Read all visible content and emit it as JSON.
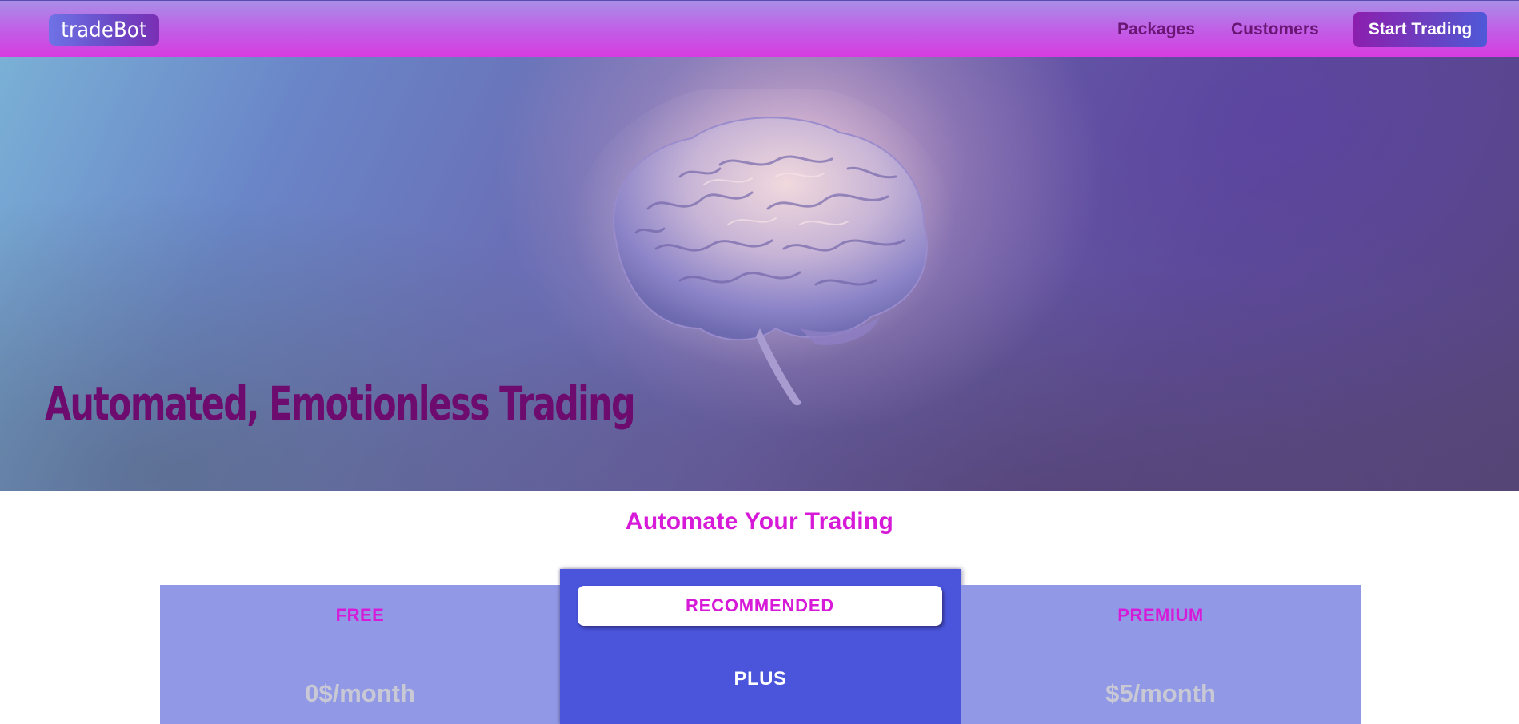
{
  "header": {
    "logo_text": "tradeBot",
    "nav": {
      "packages": "Packages",
      "customers": "Customers"
    },
    "cta_label": "Start Trading"
  },
  "hero": {
    "headline": "Automated, Emotionless Trading",
    "image": "brain-illustration"
  },
  "pricing": {
    "title": "Automate Your Trading",
    "plans": [
      {
        "name": "FREE",
        "price": "0$/month"
      },
      {
        "badge": "RECOMMENDED",
        "name": "PLUS"
      },
      {
        "name": "PREMIUM",
        "price": "$5/month"
      }
    ]
  },
  "colors": {
    "accent": "#d61ad8",
    "header_gradient_end": "#d63ce0",
    "plus_card": "#4a55dc",
    "side_card": "#9199e6",
    "headline": "#6e0b6e"
  }
}
